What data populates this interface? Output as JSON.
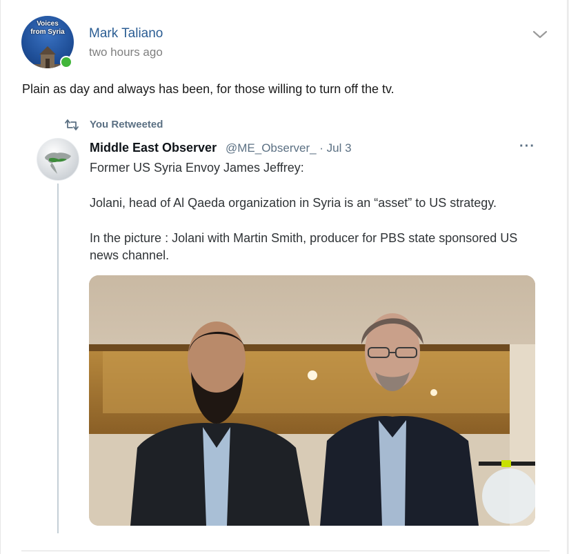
{
  "post": {
    "avatar_text_line1": "Voices",
    "avatar_text_line2": "from Syria",
    "author": "Mark Taliano",
    "time": "two hours ago",
    "text": "Plain as day and always has been, for those willing to turn off the tv."
  },
  "retweet": {
    "label": "You Retweeted",
    "name": "Middle East Observer",
    "handle_date": "@ME_Observer_ · Jul 3",
    "more": "···",
    "line1": "Former US Syria Envoy James Jeffrey:",
    "line2": "Jolani, head of Al Qaeda organization in Syria is an “asset” to US strategy.",
    "line3": "In the picture : Jolani with Martin Smith, producer for PBS state sponsored US news channel."
  },
  "colors": {
    "author_link": "#2b5d93",
    "online": "#41b53a",
    "muted": "#5b7083"
  },
  "icons": {
    "options": "chevron-down-icon",
    "retweet": "retweet-icon"
  }
}
